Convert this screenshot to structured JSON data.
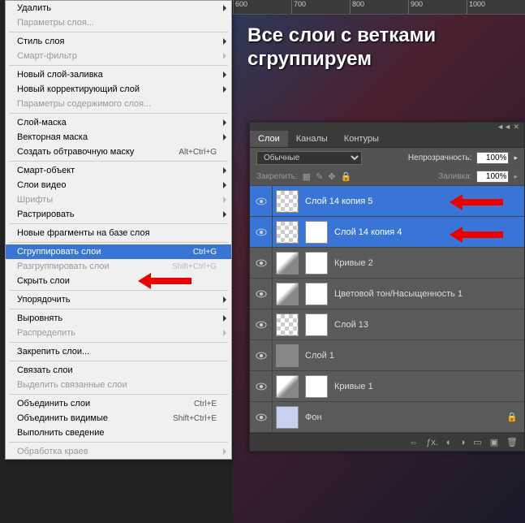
{
  "canvas": {
    "line1": "Все слои с ветками",
    "line2": "сгруппируем",
    "ruler": [
      "600",
      "700",
      "800",
      "900",
      "1000"
    ]
  },
  "menu": {
    "items": [
      {
        "label": "Удалить",
        "arrow": true
      },
      {
        "label": "Параметры слоя...",
        "disabled": true
      },
      {
        "sep": true
      },
      {
        "label": "Стиль слоя",
        "arrow": true
      },
      {
        "label": "Смарт-фильтр",
        "arrow": true,
        "disabled": true
      },
      {
        "sep": true
      },
      {
        "label": "Новый слой-заливка",
        "arrow": true
      },
      {
        "label": "Новый корректирующий слой",
        "arrow": true
      },
      {
        "label": "Параметры содержимого слоя...",
        "disabled": true
      },
      {
        "sep": true
      },
      {
        "label": "Слой-маска",
        "arrow": true
      },
      {
        "label": "Векторная маска",
        "arrow": true
      },
      {
        "label": "Создать обтравочную маску",
        "shortcut": "Alt+Ctrl+G"
      },
      {
        "sep": true
      },
      {
        "label": "Смарт-объект",
        "arrow": true
      },
      {
        "label": "Слои видео",
        "arrow": true
      },
      {
        "label": "Шрифты",
        "arrow": true,
        "disabled": true
      },
      {
        "label": "Растрировать",
        "arrow": true
      },
      {
        "sep": true
      },
      {
        "label": "Новые фрагменты на базе слоя"
      },
      {
        "sep": true
      },
      {
        "label": "Сгруппировать слои",
        "shortcut": "Ctrl+G",
        "highlighted": true
      },
      {
        "label": "Разгруппировать слои",
        "shortcut": "Shift+Ctrl+G",
        "disabled": true
      },
      {
        "label": "Скрыть слои"
      },
      {
        "sep": true
      },
      {
        "label": "Упорядочить",
        "arrow": true
      },
      {
        "sep": true
      },
      {
        "label": "Выровнять",
        "arrow": true
      },
      {
        "label": "Распределить",
        "arrow": true,
        "disabled": true
      },
      {
        "sep": true
      },
      {
        "label": "Закрепить слои..."
      },
      {
        "sep": true
      },
      {
        "label": "Связать слои"
      },
      {
        "label": "Выделить связанные слои",
        "disabled": true
      },
      {
        "sep": true
      },
      {
        "label": "Объединить слои",
        "shortcut": "Ctrl+E"
      },
      {
        "label": "Объединить видимые",
        "shortcut": "Shift+Ctrl+E"
      },
      {
        "label": "Выполнить сведение"
      },
      {
        "sep": true
      },
      {
        "label": "Обработка краев",
        "arrow": true,
        "disabled": true
      }
    ]
  },
  "panel": {
    "tabs": [
      "Слои",
      "Каналы",
      "Контуры"
    ],
    "activeTab": 0,
    "blendMode": "Обычные",
    "opacityLabel": "Непрозрачность:",
    "opacity": "100%",
    "lockLabel": "Закрепить:",
    "fillLabel": "Заливка:",
    "fill": "100%",
    "layers": [
      {
        "name": "Слой 14 копия 5",
        "selected": true,
        "thumb": "checker"
      },
      {
        "name": "Слой 14 копия 4",
        "selected": true,
        "thumb": "checker",
        "mask": true
      },
      {
        "name": "Кривые 2",
        "thumb": "curves",
        "mask": true
      },
      {
        "name": "Цветовой тон/Насыщенность 1",
        "thumb": "curves",
        "mask": true
      },
      {
        "name": "Слой 13",
        "thumb": "checker",
        "mask": true
      },
      {
        "name": "Слой 1",
        "thumb": "gray"
      },
      {
        "name": "Кривые 1",
        "thumb": "curves",
        "mask": true
      },
      {
        "name": "Фон",
        "thumb": "blue",
        "locked": true
      }
    ]
  }
}
